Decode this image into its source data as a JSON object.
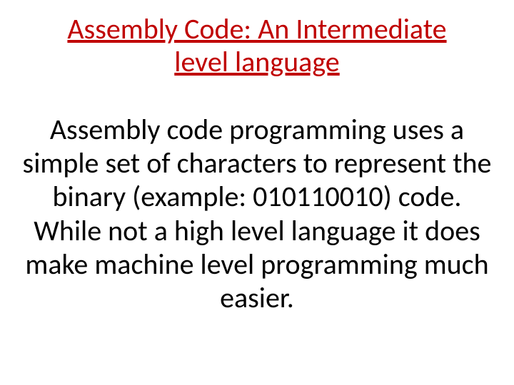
{
  "slide": {
    "title": "Assembly Code:  An Intermediate level language",
    "body": "Assembly code programming uses a simple set of characters to represent the binary (example: 010110010) code.  While not a high level language it does make machine level programming much easier."
  }
}
